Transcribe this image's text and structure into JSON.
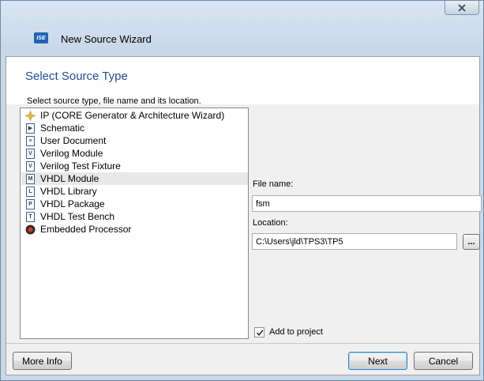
{
  "window": {
    "title": "New Source Wizard",
    "icon_text": "ISE"
  },
  "page": {
    "section_title": "Select Source Type",
    "instructions": "Select source type, file name and its location."
  },
  "source_types": [
    {
      "label": "IP (CORE Generator & Architecture Wizard)",
      "icon": "ip-core-icon"
    },
    {
      "label": "Schematic",
      "icon": "schematic-icon"
    },
    {
      "label": "User Document",
      "icon": "user-document-icon"
    },
    {
      "label": "Verilog Module",
      "icon": "verilog-module-icon"
    },
    {
      "label": "Verilog Test Fixture",
      "icon": "verilog-test-fixture-icon"
    },
    {
      "label": "VHDL Module",
      "icon": "vhdl-module-icon",
      "selected": true
    },
    {
      "label": "VHDL Library",
      "icon": "vhdl-library-icon"
    },
    {
      "label": "VHDL Package",
      "icon": "vhdl-package-icon"
    },
    {
      "label": "VHDL Test Bench",
      "icon": "vhdl-test-bench-icon"
    },
    {
      "label": "Embedded Processor",
      "icon": "embedded-processor-icon"
    }
  ],
  "form": {
    "file_name_label": "File name:",
    "file_name_value": "fsm",
    "location_label": "Location:",
    "location_value": "C:\\Users\\jld\\TPS3\\TP5",
    "browse_label": "...",
    "add_to_project_label": "Add to project",
    "add_to_project_checked": true
  },
  "buttons": {
    "more_info": "More Info",
    "next": "Next",
    "cancel": "Cancel"
  },
  "colors": {
    "title_blue": "#1f4e98",
    "selection": "#e8e8e8"
  }
}
